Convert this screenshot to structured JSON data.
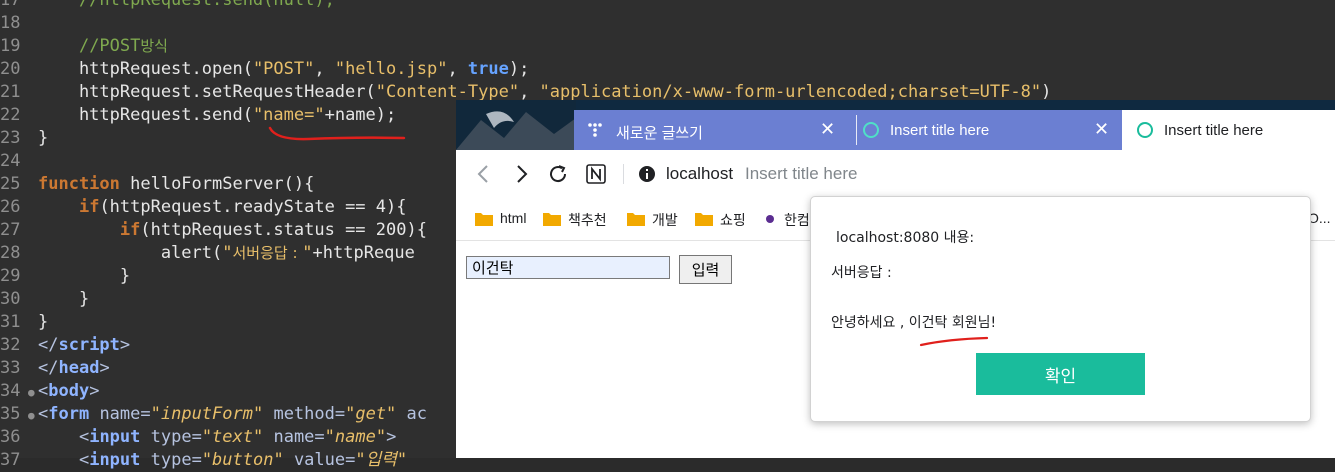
{
  "editor": {
    "lines": [
      {
        "n": "17",
        "text": "    //httpRequest.send(null);"
      },
      {
        "n": "18",
        "text": ""
      },
      {
        "n": "19",
        "comment": "//POST",
        "comment_ko": "방식"
      },
      {
        "n": "20",
        "pre": "    httpRequest.open(",
        "s1": "\"POST\"",
        "mid1": ", ",
        "s2": "\"hello.jsp\"",
        "mid2": ", ",
        "kw": "true",
        "post": ");"
      },
      {
        "n": "21",
        "pre": "    httpRequest.setRequestHeader(",
        "s1": "\"Content-Type\"",
        "mid1": ", ",
        "s2": "\"application/x-www-form-urlencoded;charset=UTF-8\"",
        "post": ")"
      },
      {
        "n": "22",
        "pre": "    httpRequest.send(",
        "s1": "\"name=\"",
        "post": "+name);"
      },
      {
        "n": "23",
        "text": "}"
      },
      {
        "n": "24",
        "text": ""
      },
      {
        "n": "25",
        "kw": "function",
        "post": " helloFormServer(){"
      },
      {
        "n": "26",
        "pre": "    ",
        "kw": "if",
        "post": "(httpRequest.readyState == 4){"
      },
      {
        "n": "27",
        "pre": "        ",
        "kw": "if",
        "post": "(httpRequest.status == 200){"
      },
      {
        "n": "28",
        "pre": "            alert(",
        "s1": "\"",
        "s1_ko": "서버응답 : ",
        "s1_end": "\"",
        "post": "+httpReque"
      },
      {
        "n": "29",
        "text": "        }"
      },
      {
        "n": "30",
        "text": "    }"
      },
      {
        "n": "31",
        "text": "}"
      },
      {
        "n": "32",
        "open": "</",
        "tag": "script",
        "close": ">"
      },
      {
        "n": "33",
        "open": "</",
        "tag": "head",
        "close": ">"
      },
      {
        "n": "34",
        "open": "<",
        "tag": "body",
        "close": ">"
      },
      {
        "n": "35",
        "open": "<",
        "tag": "form",
        "a1": " name=",
        "v1": "\"inputForm\"",
        "a2": " method=",
        "v2": "\"get\"",
        "a3": " ac"
      },
      {
        "n": "36",
        "indent": "    ",
        "open": "<",
        "tag": "input",
        "a1": " type=",
        "v1": "\"text\"",
        "a2": " name=",
        "v2": "\"name\"",
        "close": ">"
      },
      {
        "n": "37",
        "indent": "    ",
        "open": "<",
        "tag": "input",
        "a1": " type=",
        "v1": "\"button\"",
        "a2": " value=",
        "v2": "\"입력\""
      }
    ]
  },
  "browser": {
    "tabs": [
      {
        "label": "새로운 글쓰기",
        "close": "✕"
      },
      {
        "label": "Insert title here",
        "close": "✕"
      },
      {
        "label": "Insert title here"
      }
    ],
    "address": {
      "host": "localhost",
      "page_title": "Insert title here"
    },
    "bookmarks": [
      {
        "label": "html"
      },
      {
        "label": "책추천"
      },
      {
        "label": "개발"
      },
      {
        "label": "쇼핑"
      },
      {
        "label": "한컴"
      },
      {
        "label": "O..."
      }
    ],
    "page": {
      "input_value": "이건탁",
      "button_label": "입력"
    }
  },
  "alert": {
    "origin": "localhost:8080 내용:",
    "line1": "서버응답 :",
    "line2": "안녕하세요 , 이건탁 회원님!",
    "ok_label": "확인"
  },
  "colors": {
    "tab_active_bg": "#6b7fd2",
    "ok_button": "#1abc9c",
    "annotation_red": "#e0201c"
  }
}
